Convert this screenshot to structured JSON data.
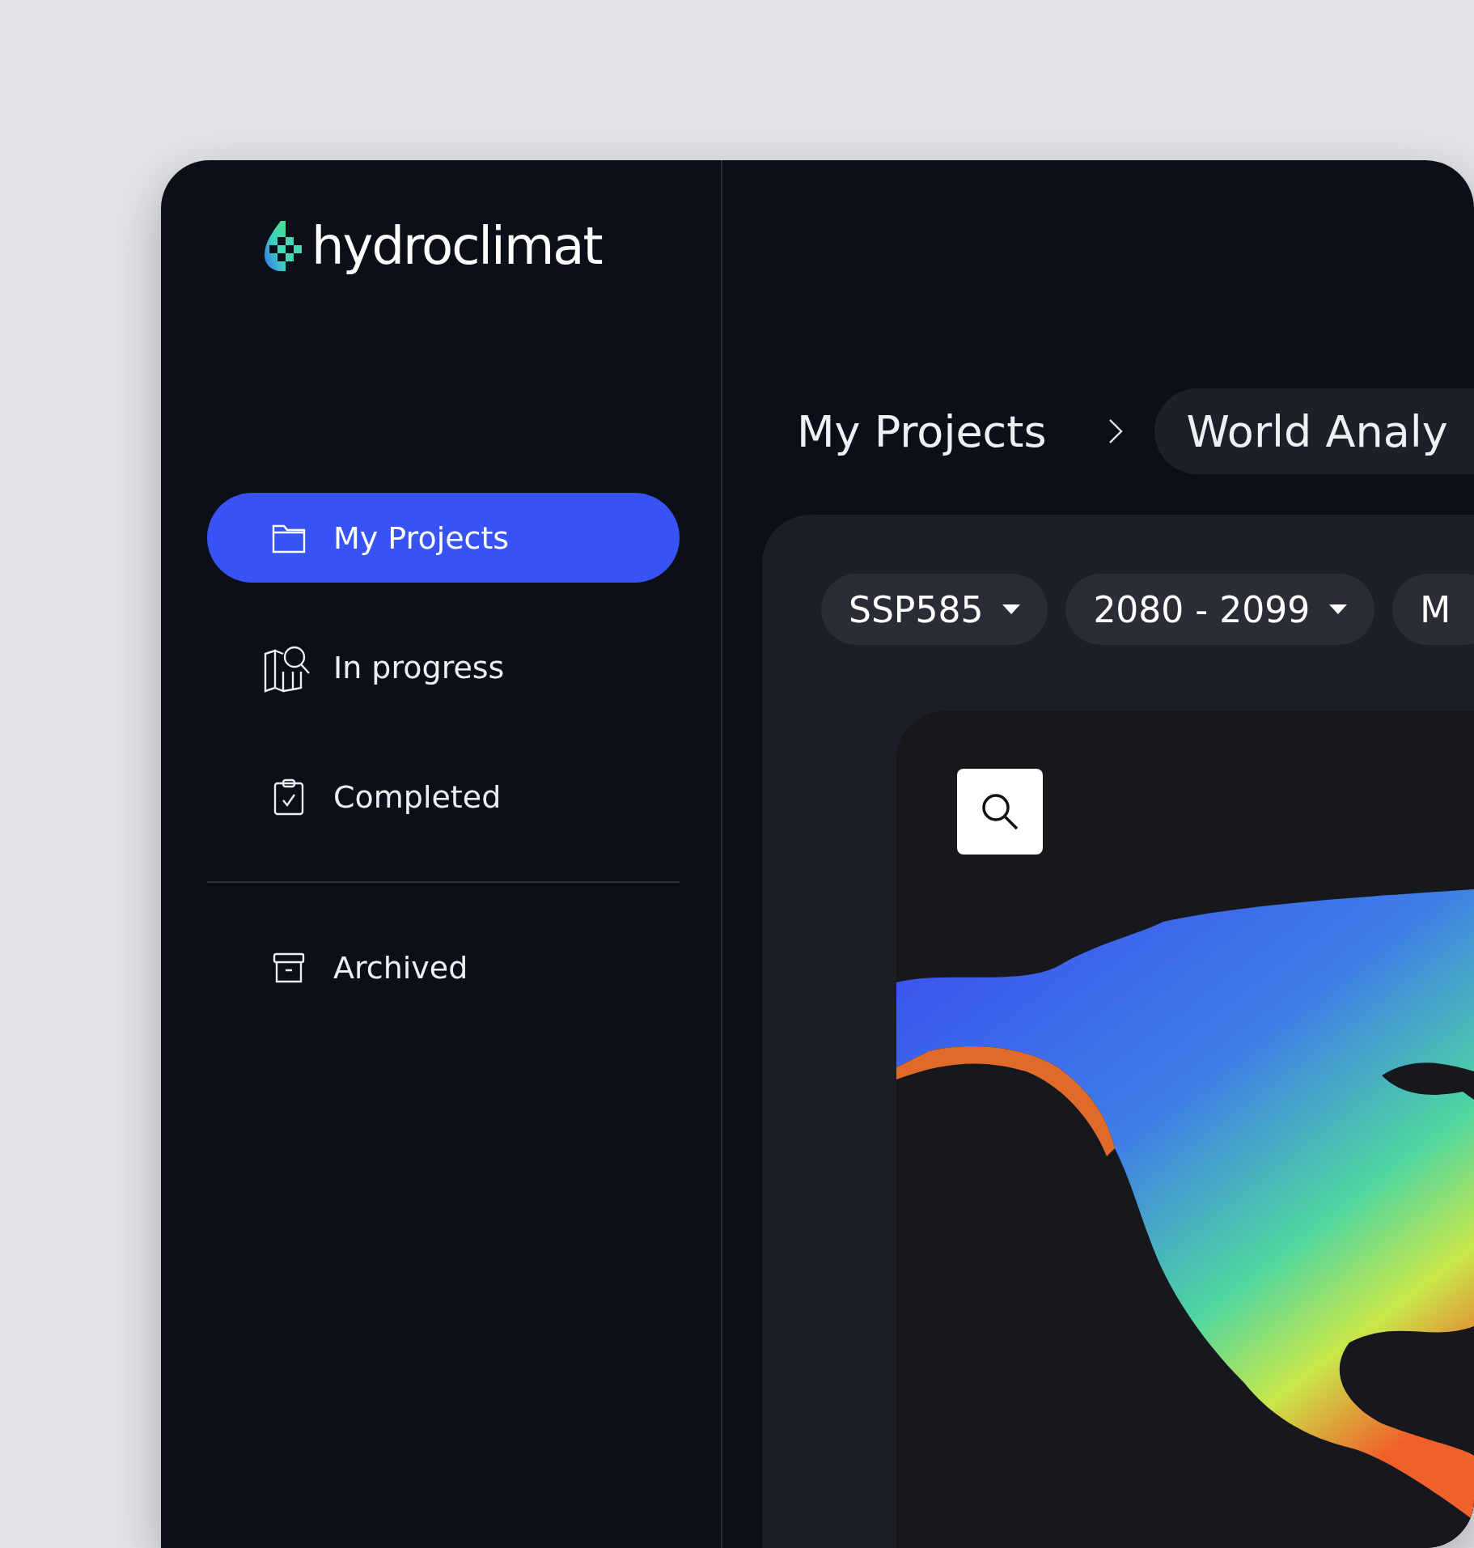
{
  "logo": {
    "text": "hydroclimat"
  },
  "sidebar": {
    "groups": [
      {
        "items": [
          {
            "label": "My Projects",
            "selected": true
          },
          {
            "label": "In progress",
            "selected": false
          },
          {
            "label": "Completed",
            "selected": false
          }
        ]
      },
      {
        "items": [
          {
            "label": "Archived",
            "selected": false
          }
        ]
      }
    ]
  },
  "breadcrumb": [
    {
      "label": "My Projects",
      "current": false
    },
    {
      "label": "World Analy",
      "current": true
    }
  ],
  "filters": [
    {
      "label": "SSP585",
      "dropdown": true
    },
    {
      "label": "2080 - 2099",
      "dropdown": true
    },
    {
      "label": "M",
      "dropdown": false
    }
  ]
}
